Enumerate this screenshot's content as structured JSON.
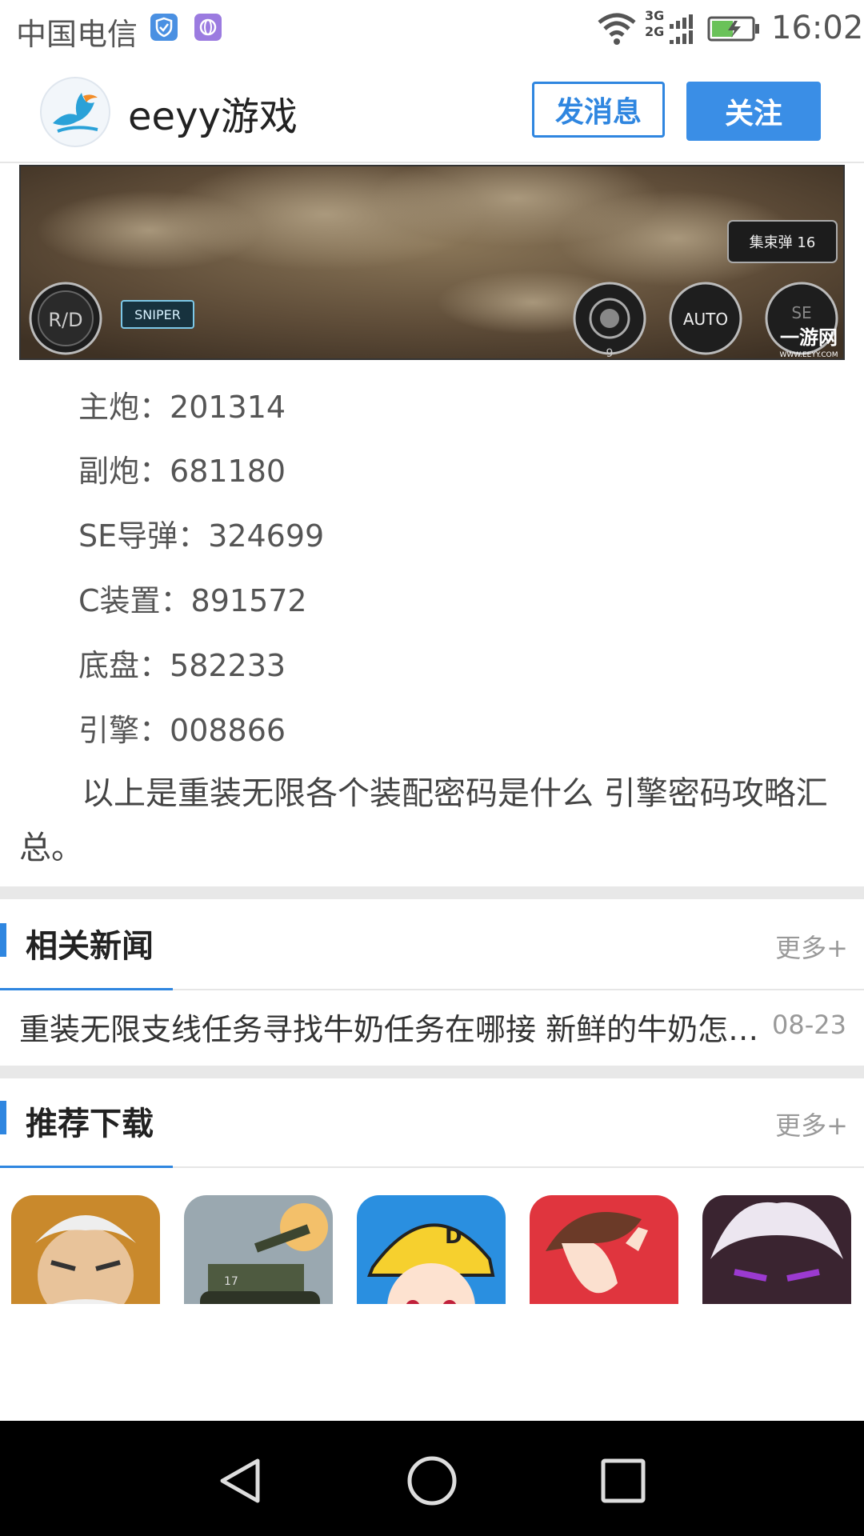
{
  "status_bar": {
    "carrier": "中国电信",
    "network_top": "3G",
    "network_bottom": "2G",
    "time": "16:02"
  },
  "header": {
    "site_name": "eeyy游戏",
    "message_button": "发消息",
    "follow_button": "关注"
  },
  "game_screenshot": {
    "sniper_label": "SNIPER",
    "ammo_label": "集束弹 16",
    "auto_label": "AUTO",
    "rd_label": "R/D",
    "se_label": "SE",
    "counter": "9",
    "watermark": "一游网",
    "watermark_url": "WWW.EEYY.COM"
  },
  "article": {
    "items": [
      {
        "label": "主炮：",
        "value": "201314"
      },
      {
        "label": "副炮：",
        "value": "681180"
      },
      {
        "label": "SE导弹：",
        "value": "324699"
      },
      {
        "label": "C装置：",
        "value": "891572"
      },
      {
        "label": "底盘：",
        "value": "582233"
      },
      {
        "label": "引擎：",
        "value": "008866"
      }
    ],
    "conclusion": "以上是重装无限各个装配密码是什么 引擎密码攻略汇总。"
  },
  "related_news": {
    "title": "相关新闻",
    "more": "更多+",
    "items": [
      {
        "title": "重装无限支线任务寻找牛奶任务在哪接 新鲜的牛奶怎么获得",
        "date": "08-23"
      }
    ]
  },
  "recommended": {
    "title": "推荐下载",
    "more": "更多+",
    "apps": [
      "hero-app-icon",
      "tank-app-icon",
      "drift-app-icon",
      "romance-app-icon",
      "anime-app-icon"
    ]
  },
  "nav": {
    "back": "back-icon",
    "home": "home-icon",
    "recent": "recent-apps-icon"
  }
}
